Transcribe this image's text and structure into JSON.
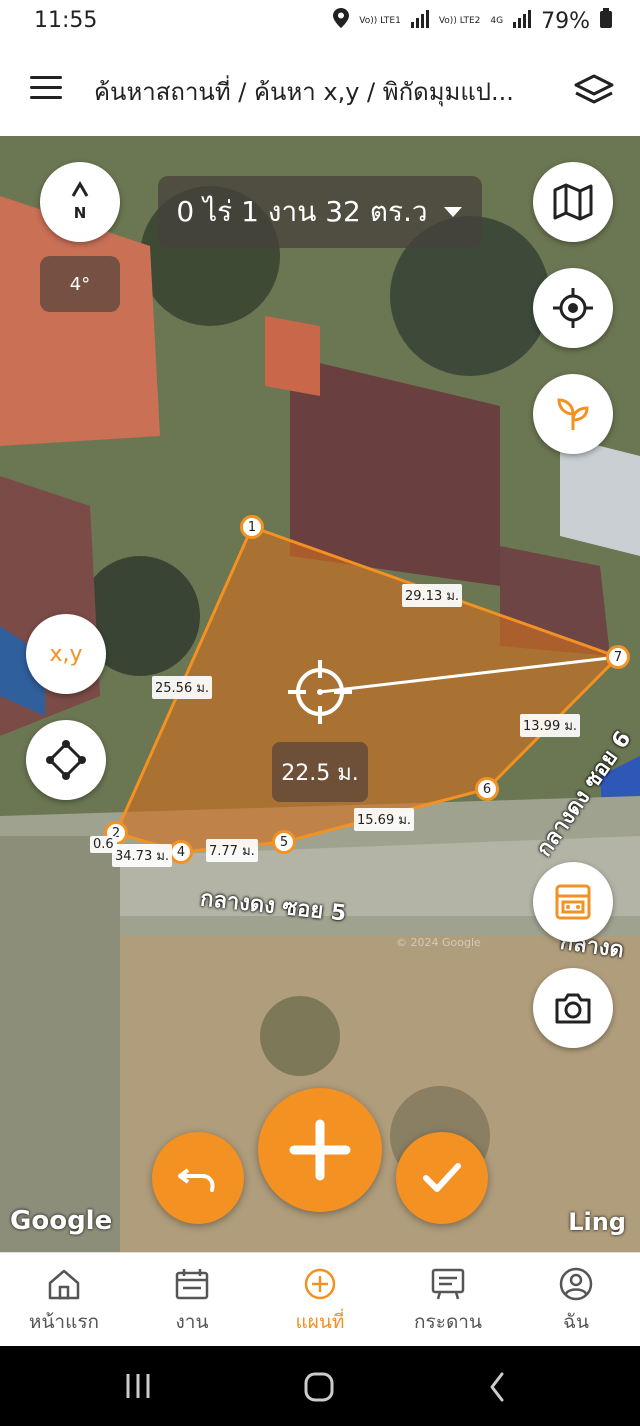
{
  "status": {
    "time": "11:55",
    "net1": "Vo)) LTE1",
    "net2": "Vo)) LTE2",
    "net_type": "4G",
    "battery": "79%"
  },
  "appbar": {
    "title": "ค้นหาสถานที่ / ค้นหา x,y / พิกัดมุมแป..."
  },
  "map": {
    "compass_label": "N",
    "rotation": "4°",
    "area_text": "0 ไร่ 1 งาน 32 ตร.ว",
    "xy_label": "x,y",
    "distance_label": "22.5 ม.",
    "points": [
      "1",
      "2",
      "4",
      "5",
      "6",
      "7"
    ],
    "measurements": {
      "m1": "29.13 ม.",
      "m2": "25.56 ม.",
      "m3": "13.99 ม.",
      "m4": "15.69 ม.",
      "m5": "7.77 ม.",
      "m6": "34.73 ม.",
      "m7": "0.6"
    },
    "roads": {
      "road1": "กลางดง ซอย 5",
      "road2": "กลางดง ซอย 6",
      "road3": "กลางด"
    },
    "watermarks": [
      "© 2024 Google"
    ],
    "google_logo": "Google",
    "ling_logo": "Ling"
  },
  "nav": {
    "items": [
      {
        "label": "หน้าแรก",
        "icon": "home-icon"
      },
      {
        "label": "งาน",
        "icon": "calendar-icon"
      },
      {
        "label": "แผนที่",
        "icon": "plus-circle-icon"
      },
      {
        "label": "กระดาน",
        "icon": "board-icon"
      },
      {
        "label": "ฉัน",
        "icon": "user-icon"
      }
    ],
    "active_index": 2
  },
  "colors": {
    "accent": "#f39122",
    "plot_fill": "#d2701f"
  }
}
